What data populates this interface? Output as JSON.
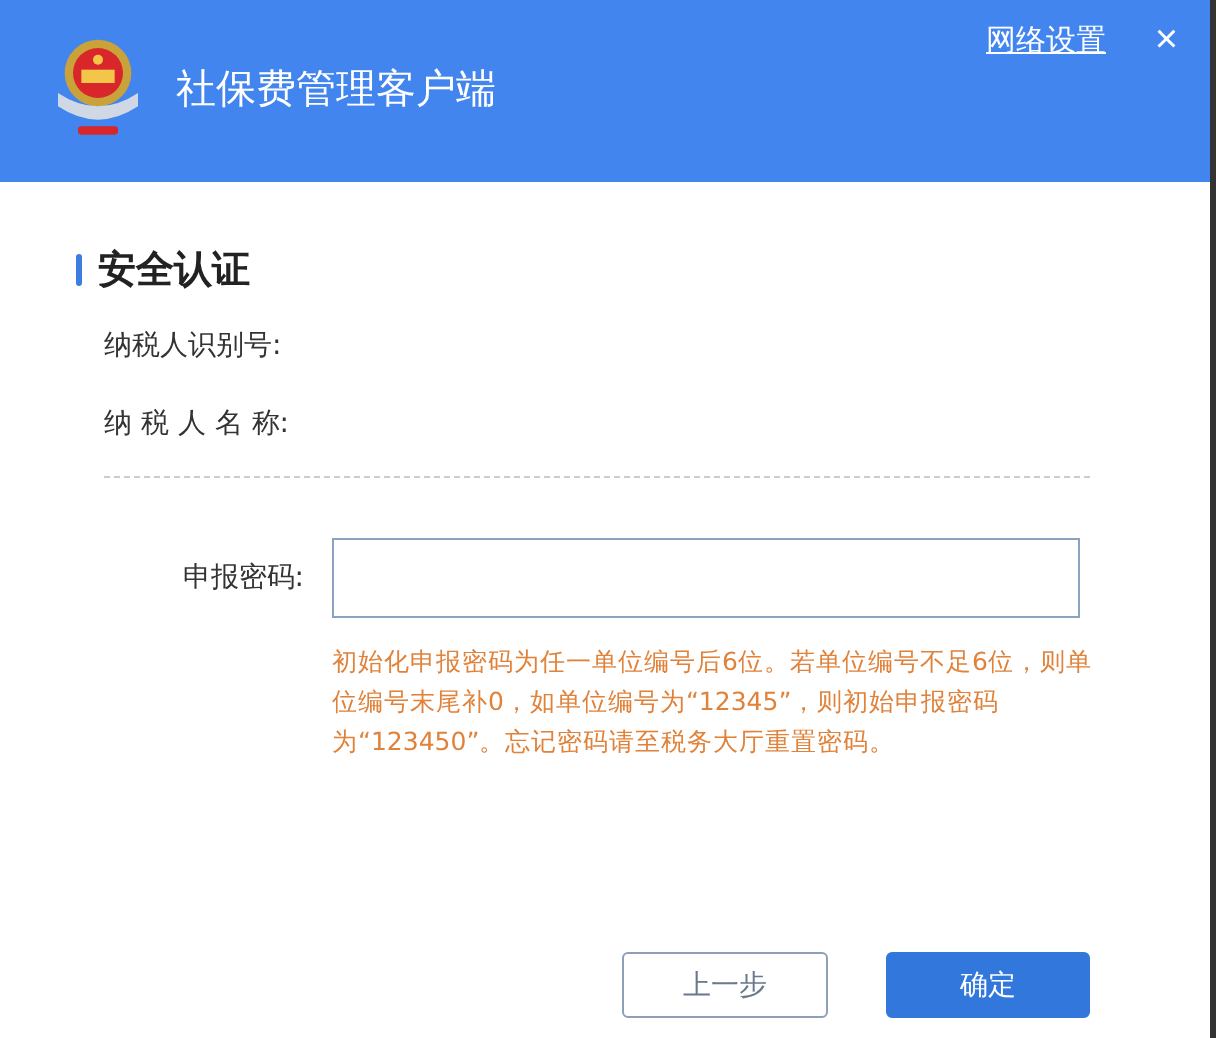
{
  "header": {
    "title": "社保费管理客户端",
    "network_link": "网络设置",
    "close": "×"
  },
  "section": {
    "title": "安全认证"
  },
  "info_rows": [
    {
      "label": "纳税人识别号:"
    },
    {
      "label": "纳 税 人 名 称:"
    }
  ],
  "password": {
    "label": "申报密码:",
    "hint": "初始化申报密码为任一单位编号后6位。若单位编号不足6位，则单位编号末尾补0，如单位编号为“12345”，则初始申报密码为“123450”。忘记密码请至税务大厅重置密码。"
  },
  "buttons": [
    {
      "label": "上一步",
      "kind": "secondary"
    },
    {
      "label": "确定",
      "kind": "primary"
    }
  ]
}
